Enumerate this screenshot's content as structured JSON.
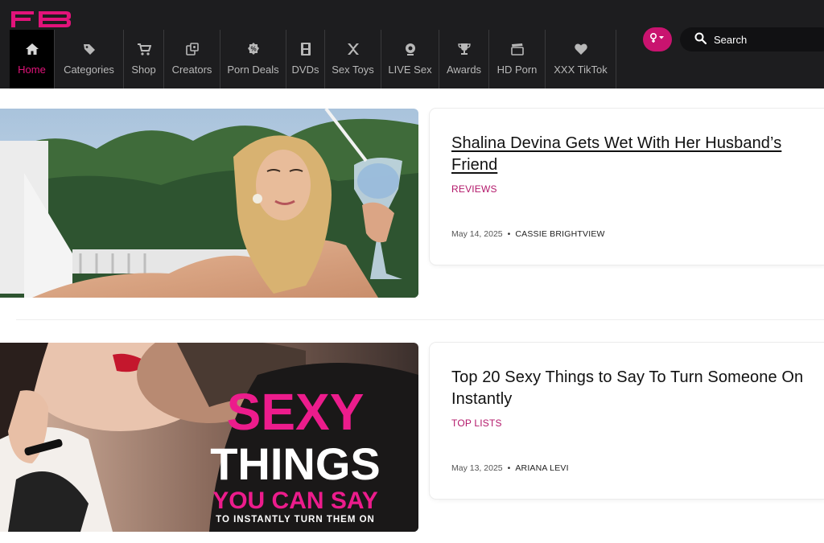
{
  "brand": {
    "logo_text": "FB",
    "accent": "#e2137a"
  },
  "nav": {
    "items": [
      {
        "label": "Home",
        "icon": "home-icon",
        "active": true
      },
      {
        "label": "Categories",
        "icon": "tag-icon"
      },
      {
        "label": "Shop",
        "icon": "cart-icon"
      },
      {
        "label": "Creators",
        "icon": "creators-icon"
      },
      {
        "label": "Porn Deals",
        "icon": "deal-tag-icon"
      },
      {
        "label": "DVDs",
        "icon": "film-strip-icon"
      },
      {
        "label": "Sex Toys",
        "icon": "toy-icon"
      },
      {
        "label": "LIVE Sex",
        "icon": "webcam-icon"
      },
      {
        "label": "Awards",
        "icon": "trophy-icon"
      },
      {
        "label": "HD Porn",
        "icon": "clapperboard-icon"
      },
      {
        "label": "XXX TikTok",
        "icon": "heart-icon"
      }
    ]
  },
  "search": {
    "placeholder": "Search"
  },
  "articles": [
    {
      "title": "Shalina Devina Gets Wet With Her Husband’s Friend",
      "category": "REVIEWS",
      "date": "May 14, 2025",
      "author": "CASSIE BRIGHTVIEW"
    },
    {
      "title": "Top 20 Sexy Things to Say To Turn Someone On Instantly",
      "category": "TOP LISTS",
      "date": "May 13, 2025",
      "author": "ARIANA LEVI",
      "image_text": {
        "line1": "SEXY",
        "line2": "THINGS",
        "line3": "YOU CAN SAY",
        "line4": "TO INSTANTLY TURN THEM ON"
      }
    }
  ]
}
